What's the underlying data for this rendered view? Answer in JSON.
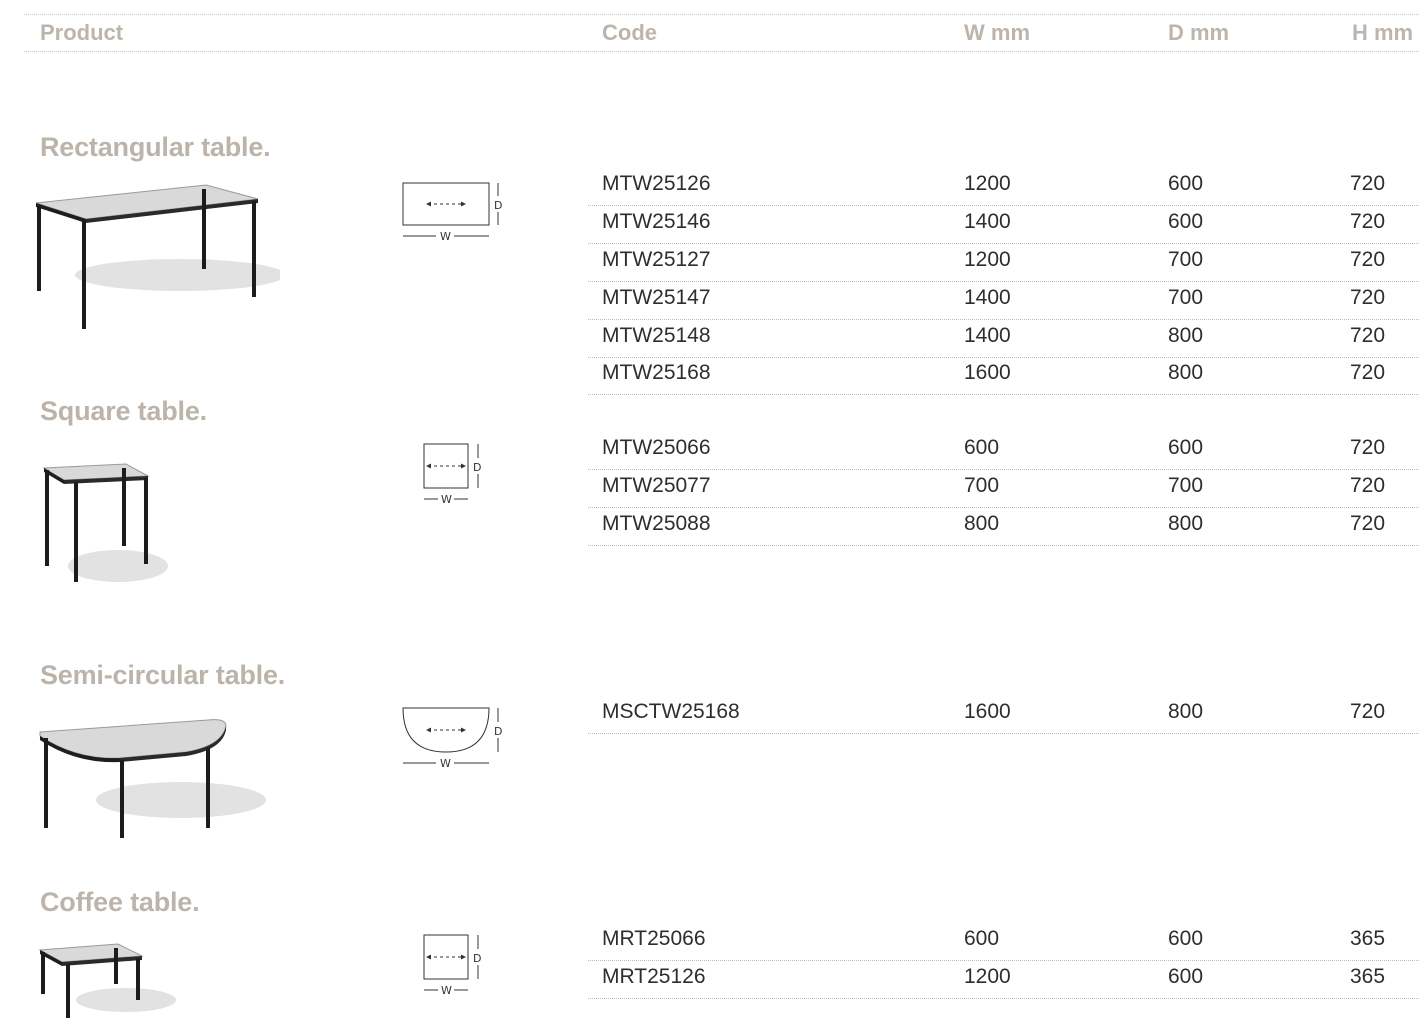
{
  "header": {
    "product": "Product",
    "code": "Code",
    "w_mm": "W mm",
    "d_mm": "D mm",
    "h_mm": "H mm"
  },
  "dimension_labels": {
    "w": "W",
    "d": "D"
  },
  "sections": [
    {
      "title": "Rectangular table.",
      "rows": [
        {
          "code": "MTW25126",
          "w": "1200",
          "d": "600",
          "h": "720"
        },
        {
          "code": "MTW25146",
          "w": "1400",
          "d": "600",
          "h": "720"
        },
        {
          "code": "MTW25127",
          "w": "1200",
          "d": "700",
          "h": "720"
        },
        {
          "code": "MTW25147",
          "w": "1400",
          "d": "700",
          "h": "720"
        },
        {
          "code": "MTW25148",
          "w": "1400",
          "d": "800",
          "h": "720"
        },
        {
          "code": "MTW25168",
          "w": "1600",
          "d": "800",
          "h": "720"
        }
      ]
    },
    {
      "title": "Square table.",
      "rows": [
        {
          "code": "MTW25066",
          "w": "600",
          "d": "600",
          "h": "720"
        },
        {
          "code": "MTW25077",
          "w": "700",
          "d": "700",
          "h": "720"
        },
        {
          "code": "MTW25088",
          "w": "800",
          "d": "800",
          "h": "720"
        }
      ]
    },
    {
      "title": "Semi-circular table.",
      "rows": [
        {
          "code": "MSCTW25168",
          "w": "1600",
          "d": "800",
          "h": "720"
        }
      ]
    },
    {
      "title": "Coffee table.",
      "rows": [
        {
          "code": "MRT25066",
          "w": "600",
          "d": "600",
          "h": "365"
        },
        {
          "code": "MRT25126",
          "w": "1200",
          "d": "600",
          "h": "365"
        }
      ]
    }
  ],
  "colors": {
    "heading": "#bcb4aa",
    "text": "#2e2e2e",
    "tabletop": "#d9d9d9",
    "frame": "#1c1c1c"
  }
}
